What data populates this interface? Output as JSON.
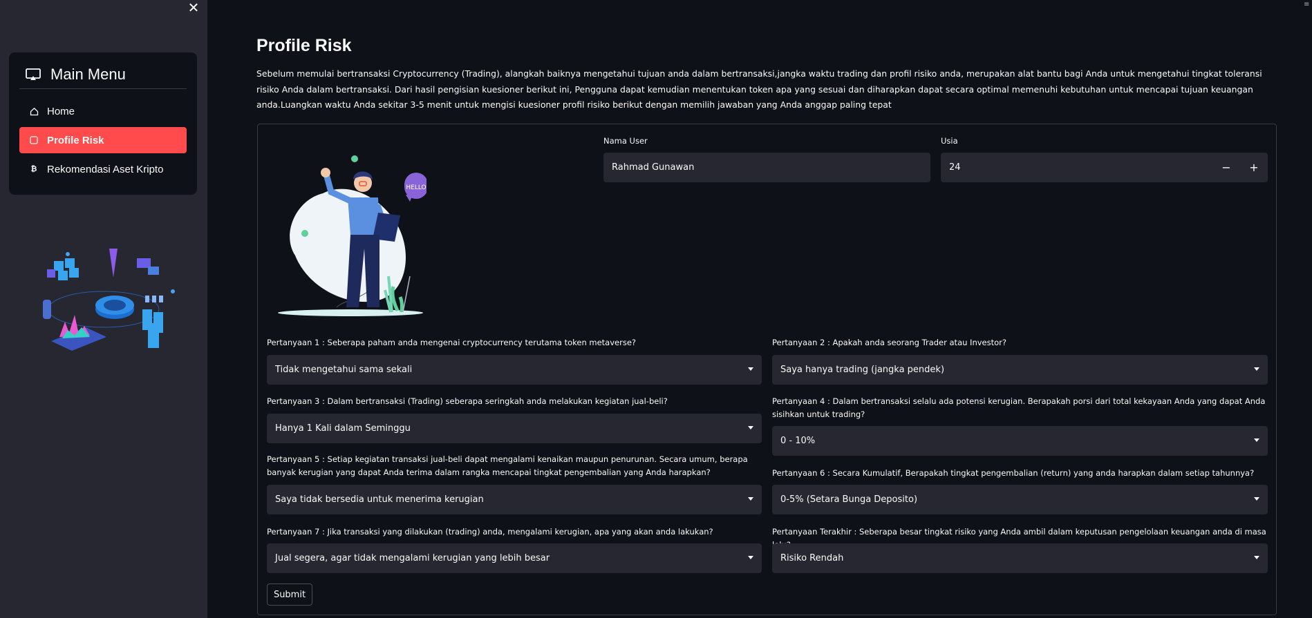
{
  "sidebar": {
    "close_label": "✕",
    "menu_title": "Main Menu",
    "items": [
      {
        "label": "Home",
        "icon": "house-icon"
      },
      {
        "label": "Profile Risk",
        "icon": "square-icon"
      },
      {
        "label": "Rekomendasi Aset Kripto",
        "icon": "bitcoin-icon"
      }
    ],
    "active_color": "#ff4b4b"
  },
  "header": {
    "menu_icon": "≡"
  },
  "main": {
    "title": "Profile Risk",
    "intro": "Sebelum memulai bertransaksi Cryptocurrency (Trading), alangkah baiknya mengetahui tujuan anda dalam bertransaksi,jangka waktu trading dan profil risiko anda, merupakan alat bantu bagi Anda untuk mengetahui tingkat toleransi risiko Anda dalam bertransaksi. Dari hasil pengisian kuesioner berikut ini, Pengguna dapat kemudian menentukan token apa yang sesuai dan diharapkan dapat secara optimal memenuhi kebutuhan untuk mencapai tujuan keuangan anda.Luangkan waktu Anda sekitar 3-5 menit untuk mengisi kuesioner profil risiko berikut dengan memilih jawaban yang Anda anggap paling tepat",
    "illustration_text": "HELLO",
    "form": {
      "name_label": "Nama User",
      "name_value": "Rahmad Gunawan",
      "age_label": "Usia",
      "age_value": "24",
      "minus": "−",
      "plus": "+",
      "questions": [
        {
          "label": "Pertanyaan 1 : Seberapa paham anda mengenai cryptocurrency terutama token metaverse?",
          "value": "Tidak mengetahui sama sekali"
        },
        {
          "label": "Pertanyaan 2 : Apakah anda seorang Trader atau Investor?",
          "value": "Saya hanya trading (jangka pendek)"
        },
        {
          "label": "Pertanyaan 3 : Dalam bertransaksi (Trading) seberapa seringkah anda melakukan kegiatan jual-beli?",
          "value": "Hanya 1 Kali dalam Seminggu"
        },
        {
          "label": "Pertanyaan 4 : Dalam bertransaksi selalu ada potensi kerugian. Berapakah porsi dari total kekayaan Anda yang dapat Anda sisihkan untuk trading?",
          "value": "0 - 10%"
        },
        {
          "label": "Pertanyaan 5 : Setiap kegiatan transaksi jual-beli dapat mengalami kenaikan maupun penurunan. Secara umum, berapa banyak kerugian yang dapat Anda terima dalam rangka mencapai tingkat pengembalian yang Anda harapkan?",
          "value": "Saya tidak bersedia untuk menerima kerugian"
        },
        {
          "label": "Pertanyaan 6 : Secara Kumulatif, Berapakah tingkat pengembalian (return) yang anda harapkan dalam setiap tahunnya?",
          "value": "0-5% (Setara Bunga Deposito)"
        },
        {
          "label": "Pertanyaan 7 : Jika transaksi yang dilakukan (trading) anda, mengalami kerugian, apa yang akan anda lakukan?",
          "value": "Jual segera, agar tidak mengalami kerugian yang lebih besar"
        },
        {
          "label": "Pertanyaan Terakhir : Seberapa besar tingkat risiko yang Anda ambil dalam keputusan pengelolaan keuangan anda di masa lalu?",
          "value": "Risiko Rendah"
        }
      ],
      "submit_label": "Submit"
    }
  }
}
